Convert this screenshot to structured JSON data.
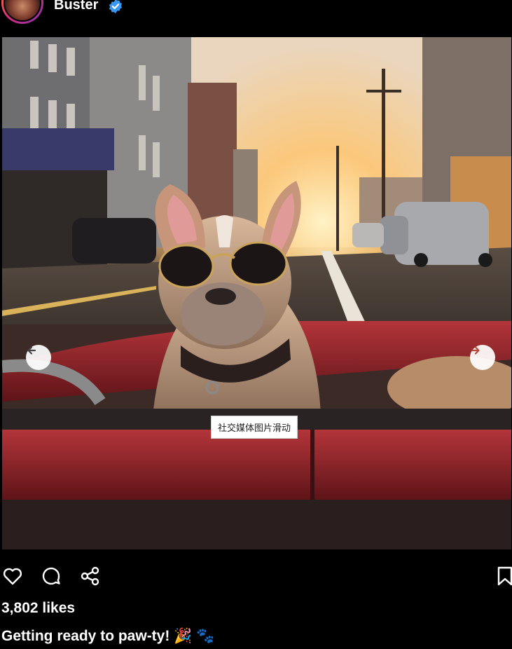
{
  "header": {
    "username": "Buster",
    "verified_icon": "verified-badge-icon",
    "verified_color": "#3897f0"
  },
  "media": {
    "alt_icons": [
      "arrow-left-icon",
      "arrow-right-icon"
    ],
    "tooltip": "社交媒体图片滑动"
  },
  "actions": {
    "like_icon": "heart-icon",
    "comment_icon": "comment-icon",
    "share_icon": "share-icon",
    "save_icon": "bookmark-icon"
  },
  "post": {
    "likes": "3,802 likes",
    "caption": "Getting ready to paw-ty! 🎉 🐾"
  }
}
